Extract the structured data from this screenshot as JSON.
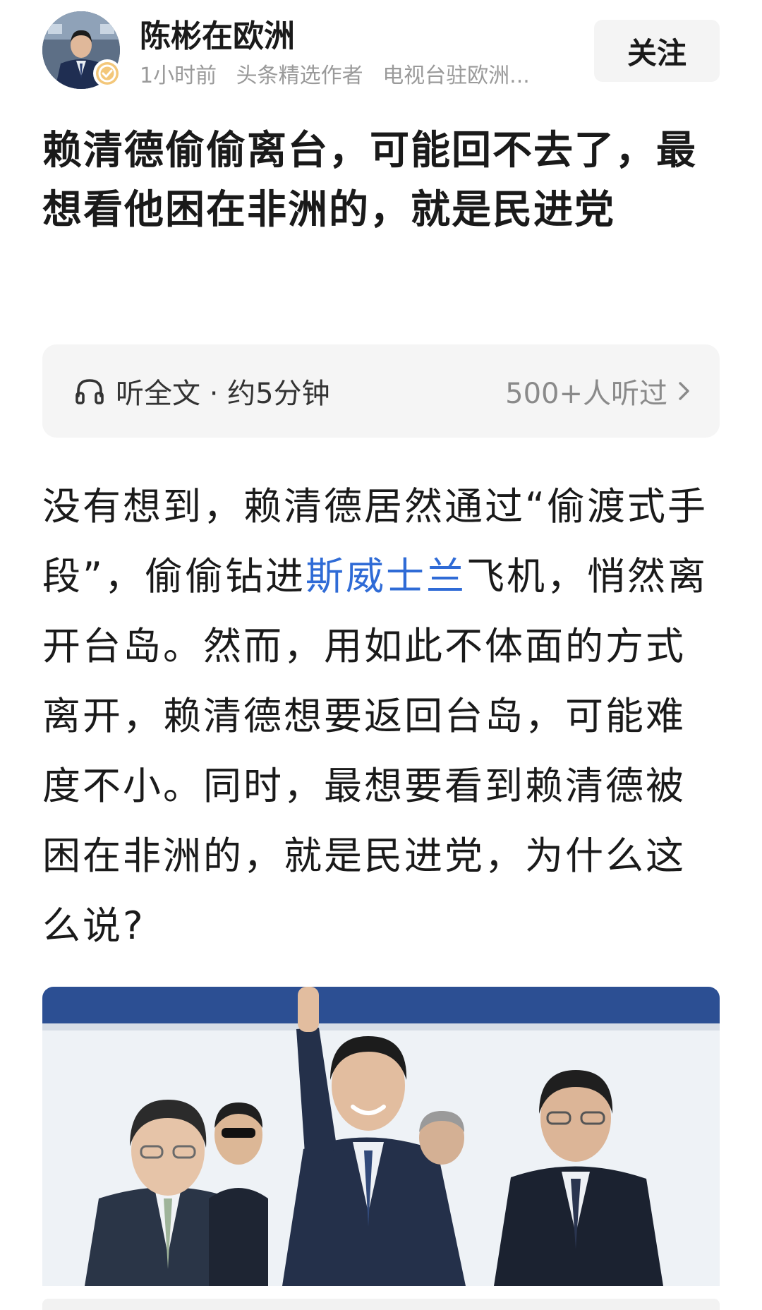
{
  "author": {
    "name": "陈彬在欧洲",
    "time": "1小时前",
    "tag1": "头条精选作者",
    "tag2": "电视台驻欧洲..."
  },
  "follow_label": "关注",
  "headline": "赖清德偷偷离台，可能回不去了，最想看他困在非洲的，就是民进党",
  "listen": {
    "label": "听全文 · 约5分钟",
    "count": "500+人听过"
  },
  "body": {
    "part1": "没有想到，赖清德居然通过“偷渡式手段”，偷偷钻进",
    "link": "斯威士兰",
    "part2": "飞机，悄然离开台岛。然而，用如此不体面的方式离开，赖清德想要返回台岛，可能难度不小。同时，最想要看到赖清德被困在非洲的，就是民进党，为什么这么说?"
  },
  "colors": {
    "link": "#2f6bd6",
    "meta": "#9a9a9a",
    "listen_bg": "#f5f5f5",
    "follow_bg": "#f4f4f4"
  },
  "icons": {
    "listen": "headphones-icon",
    "more": "chevron-right-icon",
    "verified": "verified-badge-icon"
  }
}
